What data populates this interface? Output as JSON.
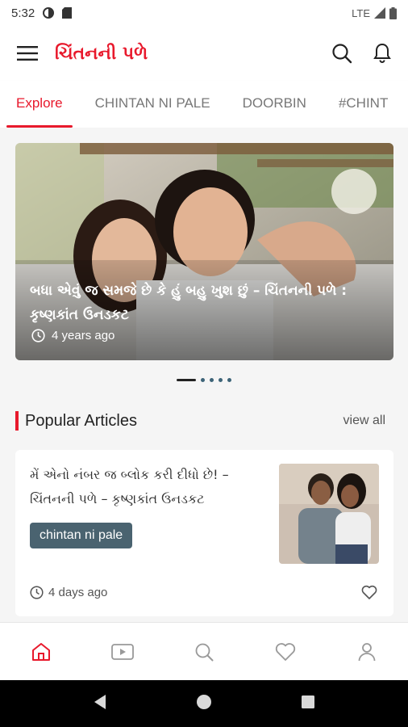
{
  "status_bar": {
    "time": "5:32",
    "network": "LTE"
  },
  "app_bar": {
    "menu_icon": "hamburger-menu-icon",
    "title": "ચિંતનની પળે",
    "search_icon": "search-icon",
    "notification_icon": "bell-icon"
  },
  "tabs": [
    {
      "label": "Explore",
      "active": true
    },
    {
      "label": "CHINTAN NI PALE",
      "active": false
    },
    {
      "label": "DOORBIN",
      "active": false
    },
    {
      "label": "#CHINT",
      "active": false
    }
  ],
  "hero": {
    "title": "બધા એવું જ સમજે છે કે હું બહુ ખુશ છું – ચિંતનની પળે : કૃષ્ણકાંત ઉનડકટ",
    "time": "4 years ago"
  },
  "carousel": {
    "total": 5,
    "active_index": 0
  },
  "popular": {
    "title": "Popular Articles",
    "view_all": "view all"
  },
  "article": {
    "title": "મેં એનો નંબર જ બ્લોક કરી દીધો છે! – ચિંતનની પળે – કૃષ્ણકાંત ઉનડકટ",
    "tag": "chintan ni pale",
    "time": "4 days ago"
  },
  "bottom_nav": [
    {
      "name": "home",
      "icon": "home-icon",
      "active": true
    },
    {
      "name": "video",
      "icon": "video-icon",
      "active": false
    },
    {
      "name": "search",
      "icon": "search-icon",
      "active": false
    },
    {
      "name": "favorites",
      "icon": "heart-icon",
      "active": false
    },
    {
      "name": "profile",
      "icon": "user-icon",
      "active": false
    }
  ],
  "colors": {
    "accent": "#e8192c",
    "tag_bg": "#4a6370",
    "dot": "#3d6478"
  }
}
